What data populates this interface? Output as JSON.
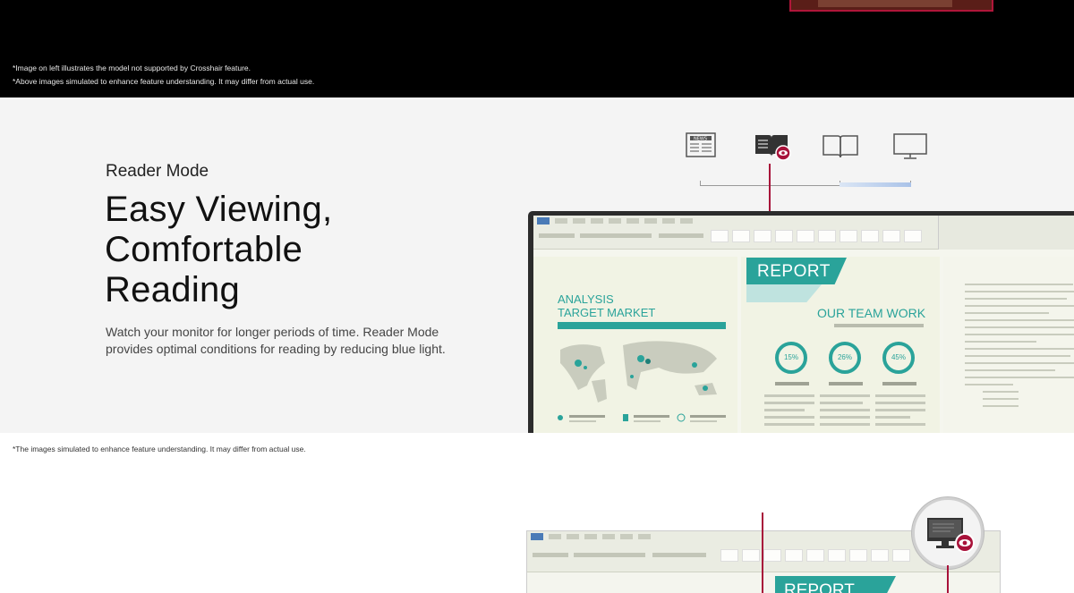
{
  "top_notes": {
    "line1": "*Image on left illustrates the model not supported by Crosshair feature.",
    "line2": "*Above images simulated to enhance feature understanding. It may differ from actual use."
  },
  "reader_mode": {
    "eyebrow": "Reader Mode",
    "headline_line1": "Easy Viewing,",
    "headline_line2": "Comfortable",
    "headline_line3": "Reading",
    "description": "Watch your monitor for longer periods of time. Reader Mode provides optimal conditions for reading by reducing blue light.",
    "mode_icons": [
      "newspaper-icon",
      "book-reader-mode-icon",
      "open-book-icon",
      "monitor-icon"
    ],
    "selected_mode_index": 1,
    "accent_color": "#a8123a",
    "screen": {
      "analysis_title_line1": "ANALYSIS",
      "analysis_title_line2": "TARGET MARKET",
      "report_label": "REPORT",
      "team_title": "OUR TEAM WORK",
      "rings": [
        "15%",
        "26%",
        "45%"
      ],
      "teal": "#2aa39a"
    },
    "note": "*The images simulated to enhance feature understanding. It may differ from actual use."
  },
  "next_section": {
    "screen_report_label": "REPORT"
  }
}
